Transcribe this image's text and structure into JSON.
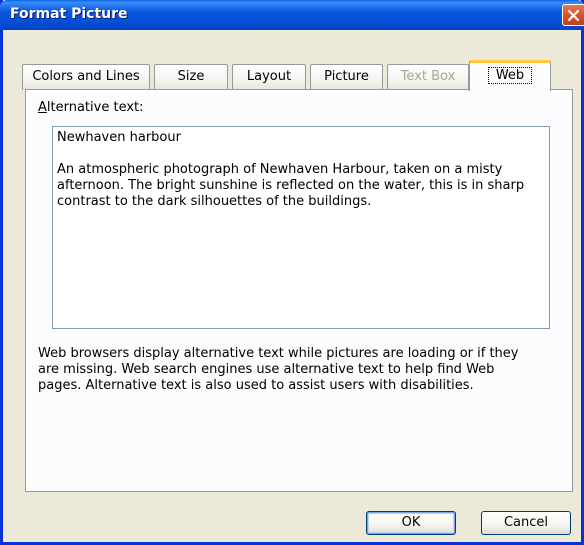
{
  "window": {
    "title": "Format Picture",
    "close_icon": "close-icon"
  },
  "tabs": [
    {
      "label": "Colors and Lines",
      "state": "normal"
    },
    {
      "label": "Size",
      "state": "normal"
    },
    {
      "label": "Layout",
      "state": "normal"
    },
    {
      "label": "Picture",
      "state": "normal"
    },
    {
      "label": "Text Box",
      "state": "disabled"
    },
    {
      "label": "Web",
      "state": "active"
    }
  ],
  "web": {
    "alt_text_label_accel": "A",
    "alt_text_label_rest": "lternative text:",
    "alt_text_lines": [
      "Newhaven harbour",
      "",
      "An atmospheric photograph of Newhaven Harbour, taken on a misty",
      "afternoon. The bright sunshine is reflected on the water, this is in sharp",
      "contrast to the dark silhouettes of the buildings."
    ],
    "help_lines": [
      "Web browsers display alternative text while pictures are loading or if they",
      "are missing.  Web search engines use alternative text to help find Web",
      "pages.  Alternative text is also used to assist users with disabilities."
    ]
  },
  "buttons": {
    "ok": "OK",
    "cancel": "Cancel"
  },
  "colors": {
    "titlebar": "#0855dd",
    "dialog_bg": "#ece9d8",
    "active_tab_accent": "#ffc83c",
    "close_button": "#d8522c"
  }
}
